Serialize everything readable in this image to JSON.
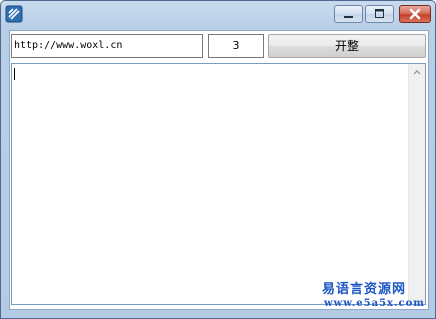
{
  "window": {
    "title": ""
  },
  "toolbar": {
    "url_value": "http://www.woxl.cn",
    "count_value": "3",
    "start_label": "开整"
  },
  "output": {
    "value": ""
  },
  "watermark": {
    "name": "易语言资源网",
    "url": "www.e5a5x.com"
  },
  "colors": {
    "titlebar": "#b9cfe8",
    "close": "#c7412b",
    "watermark": "#1d57c4"
  },
  "icons": {
    "app": "app-icon",
    "minimize": "minimize-icon",
    "maximize": "maximize-icon",
    "close": "close-icon",
    "scroll_up": "chevron-up-icon"
  }
}
